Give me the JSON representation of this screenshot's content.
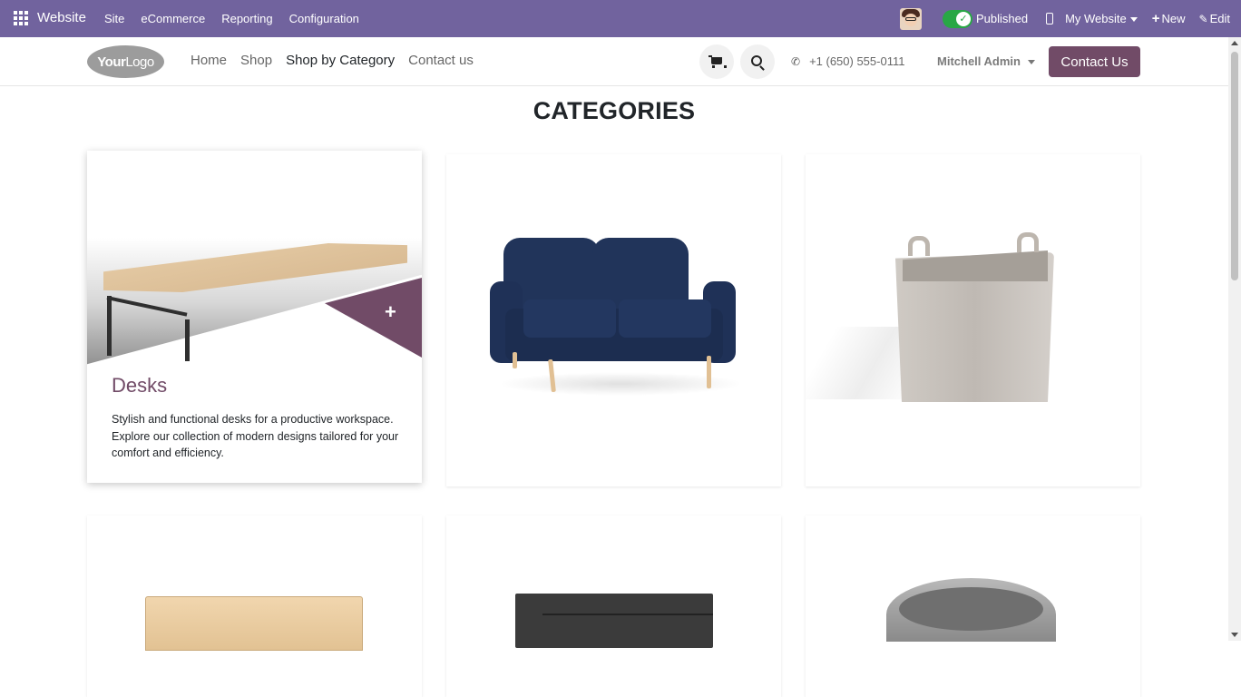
{
  "admin_bar": {
    "brand": "Website",
    "menu": [
      "Site",
      "eCommerce",
      "Reporting",
      "Configuration"
    ],
    "published_label": "Published",
    "website_label": "My Website",
    "new_label": "New",
    "edit_label": "Edit",
    "bg_color": "#71639e"
  },
  "header": {
    "logo_bold": "Your",
    "logo_light": "Logo",
    "nav": [
      "Home",
      "Shop",
      "Shop by Category",
      "Contact us"
    ],
    "active_nav": "Shop by Category",
    "phone": "+1 (650) 555-0111",
    "user": "Mitchell Admin",
    "contact_button": "Contact Us",
    "accent_color": "#714b67"
  },
  "page": {
    "title": "CATEGORIES"
  },
  "categories": [
    {
      "name": "Desks",
      "description": "Stylish and functional desks for a productive workspace. Explore our collection of modern designs tailored for your comfort and efficiency.",
      "image": "desk",
      "expanded": true
    },
    {
      "name": "",
      "image": "sofa",
      "expanded": false
    },
    {
      "name": "",
      "image": "basket",
      "expanded": false
    },
    {
      "name": "",
      "image": "box",
      "expanded": false
    },
    {
      "name": "",
      "image": "drawer",
      "expanded": false
    },
    {
      "name": "",
      "image": "bin",
      "expanded": false
    }
  ]
}
